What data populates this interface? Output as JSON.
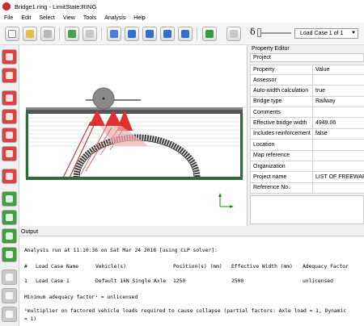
{
  "window": {
    "title": "Bridge1.ring - LimitState:RING"
  },
  "menu": [
    "File",
    "Edit",
    "Select",
    "View",
    "Tools",
    "Analysis",
    "Help"
  ],
  "toolbar": {
    "icons": [
      "new-file-icon",
      "open-folder-icon",
      "save-icon",
      "undo-icon",
      "redo-icon",
      "clipboard-icon",
      "zoom-icon",
      "zoom-window-icon",
      "zoom-extents-icon",
      "tag-icon",
      "run-analysis-icon",
      "lock-icon"
    ],
    "delta_symbol": "δ",
    "load_case": "Load Case 1 of 1"
  },
  "left_tools": [
    "select-tool-icon",
    "move-tool-icon",
    "add-node-icon",
    "add-element-icon",
    "delete-icon",
    "settings-icon",
    "material-icon",
    "mesh-icon",
    "load-icon",
    "results-icon",
    "print-icon"
  ],
  "property_editor": {
    "title": "Property Editor",
    "section": "Project",
    "headers": {
      "property": "Property",
      "value": "Value"
    },
    "rows": [
      {
        "property": "Assessor",
        "value": ""
      },
      {
        "property": "Auto-width calculation",
        "value": "true"
      },
      {
        "property": "Bridge type",
        "value": "Railway"
      },
      {
        "property": "Comments",
        "value": ""
      },
      {
        "property": "Effective bridge width",
        "value": "4949.06"
      },
      {
        "property": "Includes reinforcement",
        "value": "false"
      },
      {
        "property": "Location",
        "value": ""
      },
      {
        "property": "Map reference",
        "value": ""
      },
      {
        "property": "Organization",
        "value": ""
      },
      {
        "property": "Project name",
        "value": "LIST OF FREEWARE"
      },
      {
        "property": "Reference No.",
        "value": ""
      }
    ]
  },
  "canvas": {
    "axis_x": "x",
    "axis_y": "y"
  },
  "output": {
    "title": "Output",
    "run_line": "Analysis run at 11:10:36 on Sat Mar 24 2018 [using CLP solver]:",
    "table_headers": [
      "#",
      "Load Case Name",
      "Vehicle(s)",
      "Position(s) (mm)",
      "Effective Width (mm)",
      "Adequacy Factor"
    ],
    "table_row": [
      "1",
      "Load Case 1",
      "Default 1kN Single Axle",
      "1250",
      "2500",
      "unlicensed"
    ],
    "min_line": "Minimum adequacy factor¹ = unlicensed",
    "footnote": "¹multiplier on factored vehicle loads required to cause collapse (partial factors: Axle load = 1, Dynamic",
    "footnote2": "= 1)"
  },
  "colors": {
    "accent_red": "#e03030",
    "accent_green": "#30a040",
    "deck": "#555555",
    "ground": "#2e6b3a"
  }
}
